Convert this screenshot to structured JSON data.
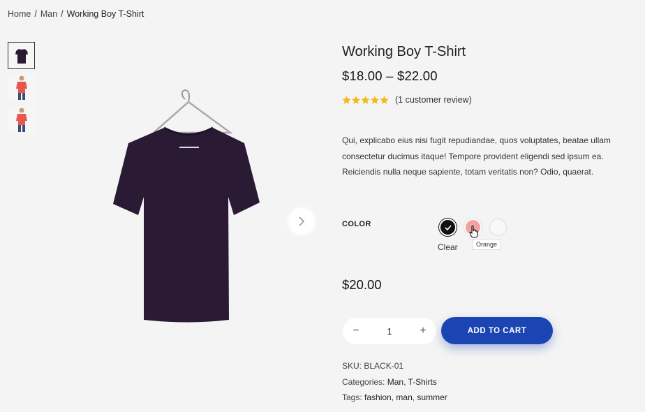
{
  "breadcrumb": {
    "home": "Home",
    "separator": "/",
    "category": "Man",
    "current": "Working Boy T-Shirt"
  },
  "thumbnails": [
    {
      "icon": "tshirt-black-icon",
      "color": "#2a1a33"
    },
    {
      "icon": "model-red-tshirt-icon",
      "color": "#e8574c"
    },
    {
      "icon": "model-red-tshirt-icon",
      "color": "#e8574c"
    }
  ],
  "product": {
    "title": "Working Boy T-Shirt",
    "price_range": "$18.00 – $22.00",
    "rating": 5,
    "review_text": "(1 customer review)",
    "description": "Qui, explicabo eius nisi fugit repudiandae, quos voluptates, beatae ullam consectetur ducimus itaque! Tempore provident eligendi sed ipsum ea. Reiciendis nulla neque sapiente, totam veritatis non? Odio, quaerat.",
    "shirt_color": "#2a1a33"
  },
  "variations": {
    "label": "COLOR",
    "clear": "Clear",
    "tooltip": "Orange",
    "swatches": [
      {
        "name": "Black",
        "color": "#111111",
        "selected": true
      },
      {
        "name": "Orange",
        "color": "#f0a3a2",
        "selected": false
      },
      {
        "name": "White",
        "color": "#f8f8f8",
        "selected": false
      }
    ]
  },
  "variation_price": "$20.00",
  "cart": {
    "quantity": "1",
    "minus": "−",
    "plus": "+",
    "add_label": "ADD TO CART",
    "button_color": "#1b45b3"
  },
  "meta": {
    "sku_label": "SKU:",
    "sku": "BLACK-01",
    "categories_label": "Categories:",
    "categories": [
      "Man",
      "T-Shirts"
    ],
    "tags_label": "Tags:",
    "tags": [
      "fashion",
      "man",
      "summer"
    ]
  }
}
